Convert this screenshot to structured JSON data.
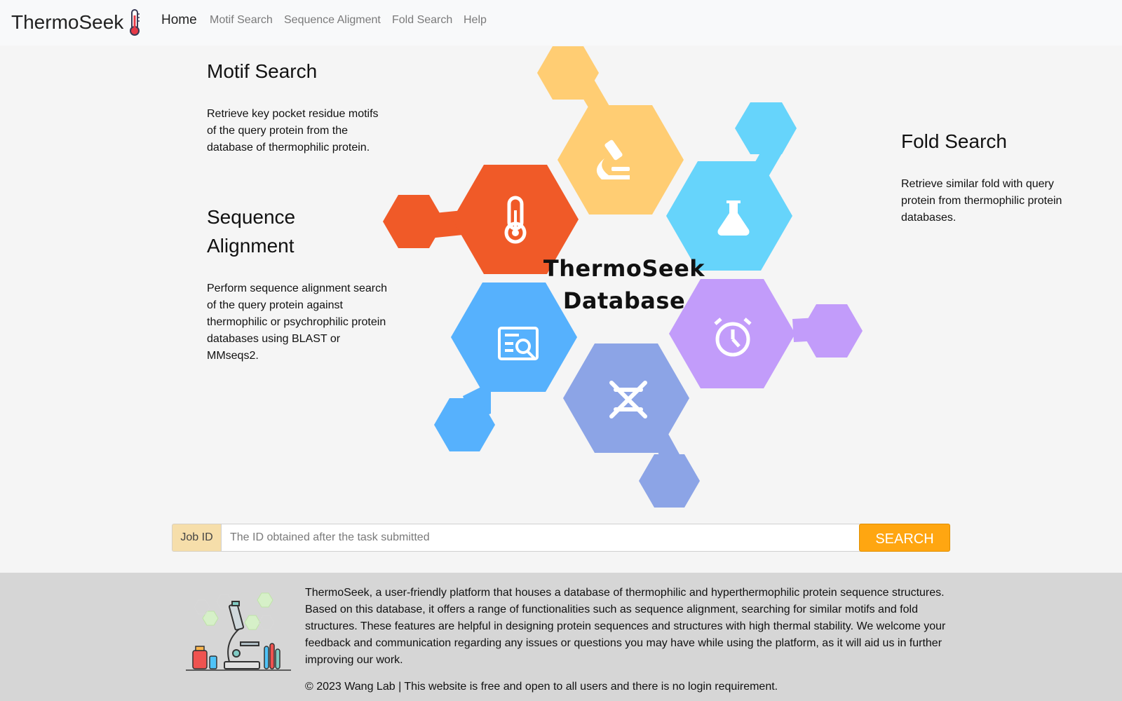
{
  "navbar": {
    "brand": "ThermoSeek",
    "links": [
      "Home",
      "Motif Search",
      "Sequence Aligment",
      "Fold Search",
      "Help"
    ]
  },
  "motif": {
    "title": "Motif Search",
    "description": "Retrieve key pocket residue motifs of the query protein from the database of thermophilic protein."
  },
  "sequence": {
    "title_line1": "Sequence",
    "title_line2": "Alignment",
    "description": "Perform sequence alignment search of the query protein against thermophilic or psychrophilic protein databases using BLAST or MMseqs2."
  },
  "fold": {
    "title": "Fold Search",
    "description": "Retrieve similar fold with query protein from thermophilic protein databases."
  },
  "graphic": {
    "title_line1": "ThermoSeek",
    "title_line2": "Database",
    "colors": {
      "orange": "#f05a28",
      "yellow": "#ffcd73",
      "cyan": "#66d4fb",
      "blue": "#56b1fd",
      "indigo": "#8ca4e6",
      "purple": "#c29cfa"
    },
    "icons": [
      "thermometer-icon",
      "microscope-icon",
      "flask-icon",
      "search-document-icon",
      "dna-icon",
      "stopwatch-icon"
    ]
  },
  "search": {
    "label": "Job ID",
    "placeholder": "The ID obtained after the task submitted",
    "button": "SEARCH"
  },
  "footer": {
    "text": "ThermoSeek, a user-friendly platform that houses a database of thermophilic and hyperthermophilic protein sequence structures. Based on this database, it offers a range of functionalities such as sequence alignment, searching for similar motifs and fold structures. These features are helpful in designing protein sequences and structures with high thermal stability. We welcome your feedback and communication regarding any issues or questions you may have while using the platform, as it will aid us in further improving our work.",
    "copyright": "© 2023 Wang Lab | This website is free and open to all users and there is no login requirement."
  }
}
